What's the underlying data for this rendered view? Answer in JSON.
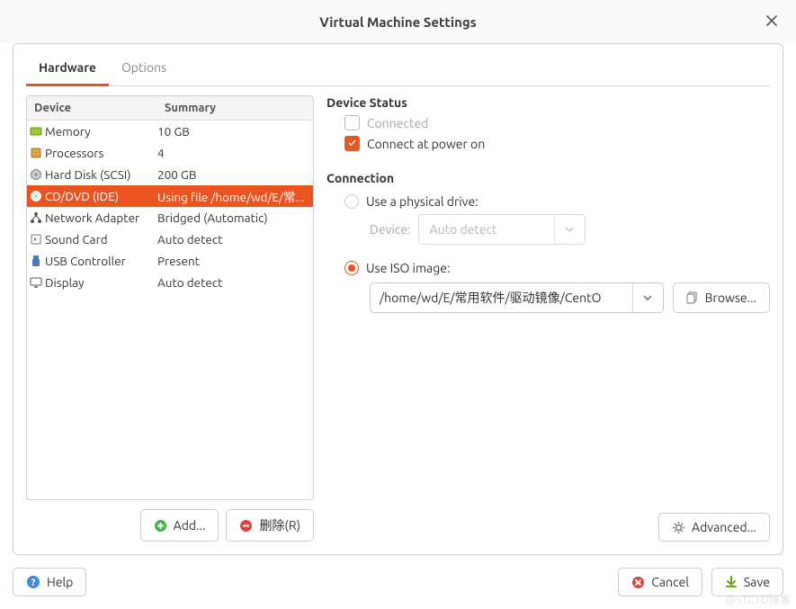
{
  "window": {
    "title": "Virtual Machine Settings"
  },
  "tabs": {
    "hardware": "Hardware",
    "options": "Options"
  },
  "table": {
    "col_device": "Device",
    "col_summary": "Summary",
    "rows": [
      {
        "name": "Memory",
        "summary": "10 GB"
      },
      {
        "name": "Processors",
        "summary": "4"
      },
      {
        "name": "Hard Disk (SCSI)",
        "summary": "200 GB"
      },
      {
        "name": "CD/DVD (IDE)",
        "summary": "Using file /home/wd/E/常..."
      },
      {
        "name": "Network Adapter",
        "summary": "Bridged (Automatic)"
      },
      {
        "name": "Sound Card",
        "summary": "Auto detect"
      },
      {
        "name": "USB Controller",
        "summary": "Present"
      },
      {
        "name": "Display",
        "summary": "Auto detect"
      }
    ],
    "selected_index": 3
  },
  "buttons": {
    "add": "Add...",
    "remove": "删除(R)",
    "browse": "Browse...",
    "advanced": "Advanced...",
    "help": "Help",
    "cancel": "Cancel",
    "save": "Save"
  },
  "details": {
    "status_title": "Device Status",
    "connected": "Connected",
    "connect_power_on": "Connect at power on",
    "connection_title": "Connection",
    "use_physical": "Use a physical drive:",
    "device_label": "Device:",
    "device_select": "Auto detect",
    "use_iso": "Use ISO image:",
    "iso_path": "/home/wd/E/常用软件/驱动镜像/CentO"
  },
  "watermark": "@51CTO博客"
}
